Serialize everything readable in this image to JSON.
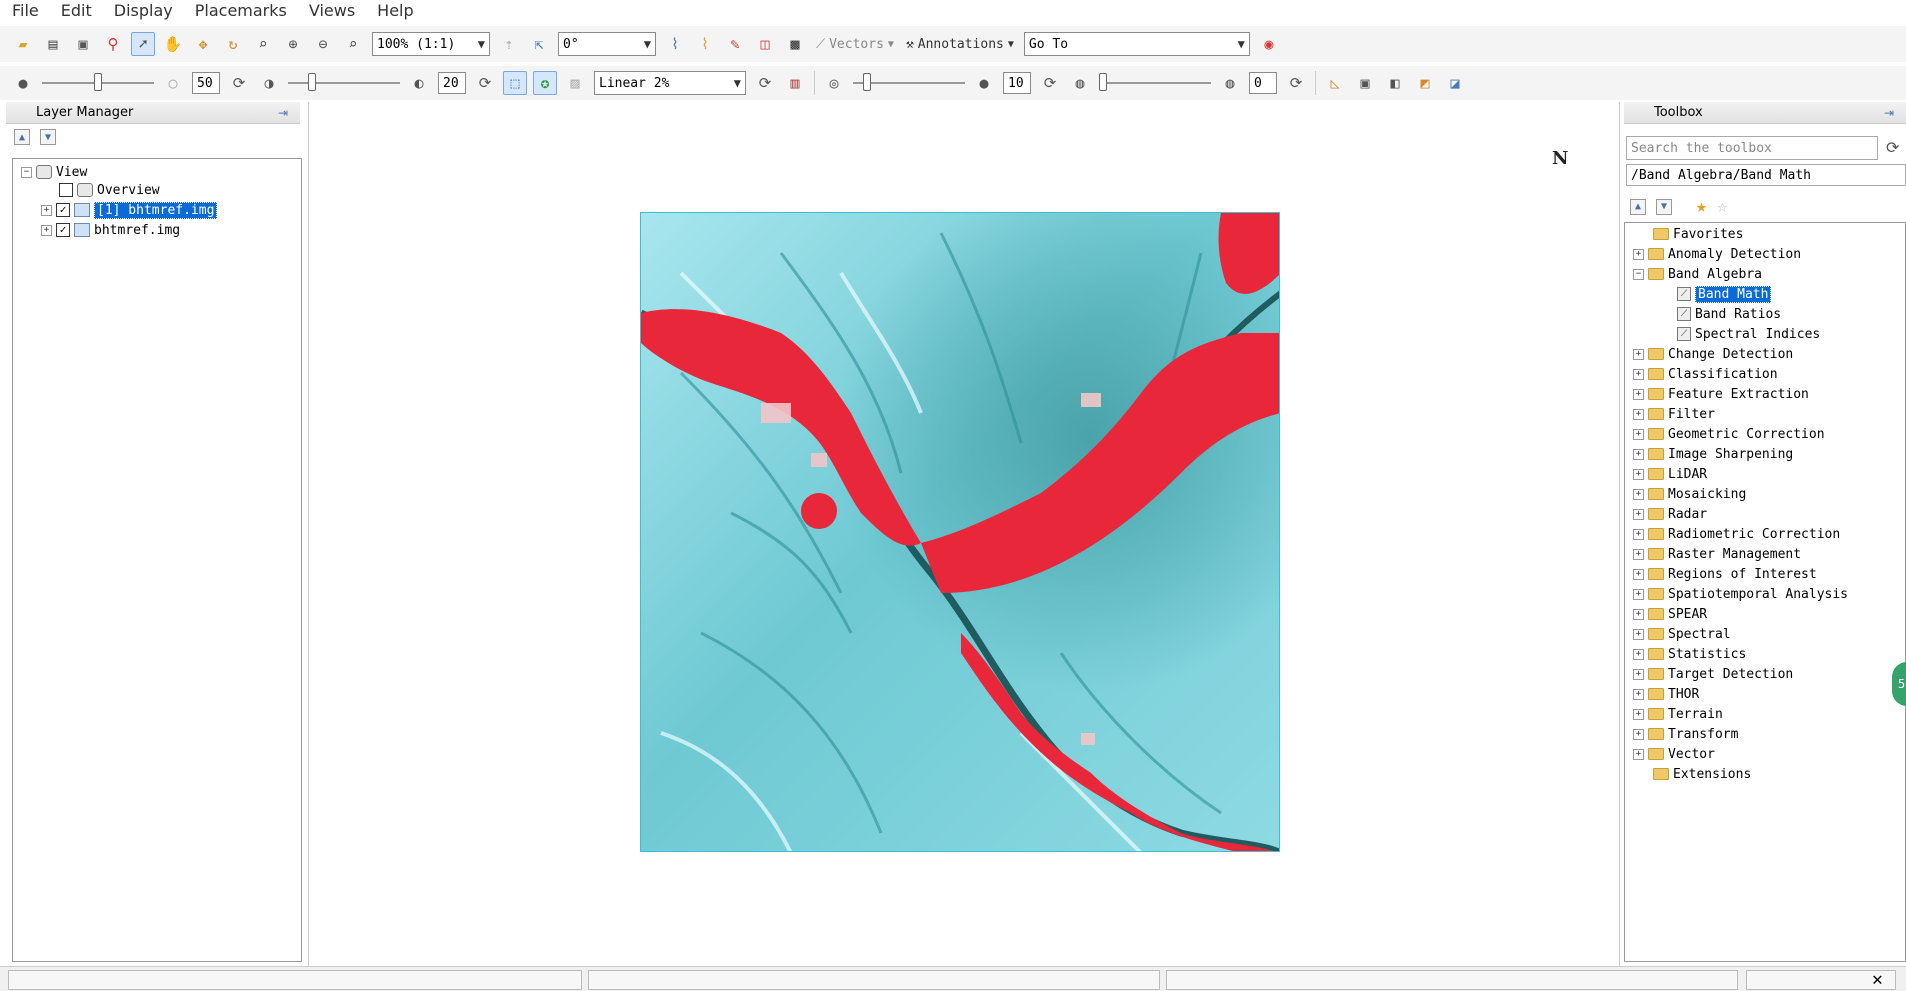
{
  "menu": [
    "File",
    "Edit",
    "Display",
    "Placemarks",
    "Views",
    "Help"
  ],
  "toolbar1": {
    "zoom_value": "100% (1:1)",
    "rotation_value": "0°",
    "vectors_label": "Vectors",
    "annotations_label": "Annotations",
    "goto_value": "Go To"
  },
  "toolbar2": {
    "brightness_value": "50",
    "contrast_value": "20",
    "stretch_value": "Linear 2%",
    "sharpen_value": "10",
    "transparency_value": "0"
  },
  "layer_manager": {
    "title": "Layer Manager",
    "view_label": "View",
    "overview_label": "Overview",
    "layer1_label": "[1] bhtmref.img",
    "layer2_label": "bhtmref.img"
  },
  "view": {
    "north_label": "N",
    "colors": {
      "vegetation_red": "#e8283a",
      "terrain_cyan": "#7ed6e0",
      "frame": "#36c0d0"
    }
  },
  "toolbox": {
    "title": "Toolbox",
    "search_placeholder": "Search the toolbox",
    "path": "/Band Algebra/Band Math",
    "items": [
      {
        "label": "Favorites"
      },
      {
        "label": "Anomaly Detection"
      },
      {
        "label": "Band Algebra"
      },
      {
        "label": "Band Math"
      },
      {
        "label": "Band Ratios"
      },
      {
        "label": "Spectral Indices"
      },
      {
        "label": "Change Detection"
      },
      {
        "label": "Classification"
      },
      {
        "label": "Feature Extraction"
      },
      {
        "label": "Filter"
      },
      {
        "label": "Geometric Correction"
      },
      {
        "label": "Image Sharpening"
      },
      {
        "label": "LiDAR"
      },
      {
        "label": "Mosaicking"
      },
      {
        "label": "Radar"
      },
      {
        "label": "Radiometric Correction"
      },
      {
        "label": "Raster Management"
      },
      {
        "label": "Regions of Interest"
      },
      {
        "label": "Spatiotemporal Analysis"
      },
      {
        "label": "SPEAR"
      },
      {
        "label": "Spectral"
      },
      {
        "label": "Statistics"
      },
      {
        "label": "Target Detection"
      },
      {
        "label": "THOR"
      },
      {
        "label": "Terrain"
      },
      {
        "label": "Transform"
      },
      {
        "label": "Vector"
      },
      {
        "label": "Extensions"
      }
    ]
  },
  "badge": "5"
}
